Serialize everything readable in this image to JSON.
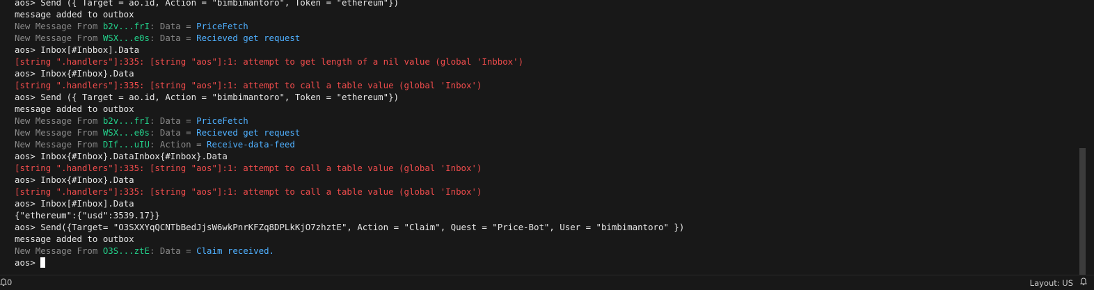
{
  "terminal": {
    "lines": [
      [
        {
          "t": "aos> Send ({ Target = ao.id, Action = \"bimbimantoro\", Token = \"ethereum\"})",
          "c": "def"
        }
      ],
      [
        {
          "t": "message added to outbox",
          "c": "def"
        }
      ],
      [
        {
          "t": "New Message From ",
          "c": "dim"
        },
        {
          "t": "b2v...frI",
          "c": "green"
        },
        {
          "t": ": Data = ",
          "c": "dim"
        },
        {
          "t": "PriceFetch",
          "c": "blue"
        }
      ],
      [
        {
          "t": "New Message From ",
          "c": "dim"
        },
        {
          "t": "WSX...e0s",
          "c": "green"
        },
        {
          "t": ": Data = ",
          "c": "dim"
        },
        {
          "t": "Recieved get request",
          "c": "blue"
        }
      ],
      [
        {
          "t": "aos> Inbox[#Inbbox].Data",
          "c": "def"
        }
      ],
      [
        {
          "t": "[string \".handlers\"]:335: [string \"aos\"]:1: attempt to get length of a nil value (global 'Inbbox')",
          "c": "red"
        }
      ],
      [
        {
          "t": "aos> Inbox{#Inbox}.Data",
          "c": "def"
        }
      ],
      [
        {
          "t": "[string \".handlers\"]:335: [string \"aos\"]:1: attempt to call a table value (global 'Inbox')",
          "c": "red"
        }
      ],
      [
        {
          "t": "aos> Send ({ Target = ao.id, Action = \"bimbimantoro\", Token = \"ethereum\"})",
          "c": "def"
        }
      ],
      [
        {
          "t": "message added to outbox",
          "c": "def"
        }
      ],
      [
        {
          "t": "New Message From ",
          "c": "dim"
        },
        {
          "t": "b2v...frI",
          "c": "green"
        },
        {
          "t": ": Data = ",
          "c": "dim"
        },
        {
          "t": "PriceFetch",
          "c": "blue"
        }
      ],
      [
        {
          "t": "New Message From ",
          "c": "dim"
        },
        {
          "t": "WSX...e0s",
          "c": "green"
        },
        {
          "t": ": Data = ",
          "c": "dim"
        },
        {
          "t": "Recieved get request",
          "c": "blue"
        }
      ],
      [
        {
          "t": "New Message From ",
          "c": "dim"
        },
        {
          "t": "DIf...uIU",
          "c": "green"
        },
        {
          "t": ": Action = ",
          "c": "dim"
        },
        {
          "t": "Receive-data-feed",
          "c": "blue"
        }
      ],
      [
        {
          "t": "aos> Inbox{#Inbox}.DataInbox{#Inbox}.Data",
          "c": "def"
        }
      ],
      [
        {
          "t": "[string \".handlers\"]:335: [string \"aos\"]:1: attempt to call a table value (global 'Inbox')",
          "c": "red"
        }
      ],
      [
        {
          "t": "aos> Inbox{#Inbox}.Data",
          "c": "def"
        }
      ],
      [
        {
          "t": "[string \".handlers\"]:335: [string \"aos\"]:1: attempt to call a table value (global 'Inbox')",
          "c": "red"
        }
      ],
      [
        {
          "t": "aos> Inbox[#Inbox].Data",
          "c": "def"
        }
      ],
      [
        {
          "t": "{\"ethereum\":{\"usd\":3539.17}}",
          "c": "def"
        }
      ],
      [
        {
          "t": "aos> Send({Target= \"O3SXXYqQCNTbBedJjsW6wkPnrKFZq8DPLkKjO7zhztE\", Action = \"Claim\", Quest = \"Price-Bot\", User = \"bimbimantoro\" })",
          "c": "def"
        }
      ],
      [
        {
          "t": "message added to outbox",
          "c": "def"
        }
      ],
      [
        {
          "t": "New Message From ",
          "c": "dim"
        },
        {
          "t": "O3S...ztE",
          "c": "green"
        },
        {
          "t": ": Data = ",
          "c": "dim"
        },
        {
          "t": "Claim received.",
          "c": "blue"
        }
      ]
    ],
    "prompt": "aos> "
  },
  "statusbar": {
    "bell_icon": "bell-icon",
    "notification_count": "0",
    "layout_label": "Layout: US"
  },
  "colors": {
    "background": "#181818",
    "default_text": "#e6e6e6",
    "dim_text": "#8a8a8a",
    "process_id": "#23d18b",
    "message_value": "#4fb0ff",
    "error": "#f14c4c"
  }
}
